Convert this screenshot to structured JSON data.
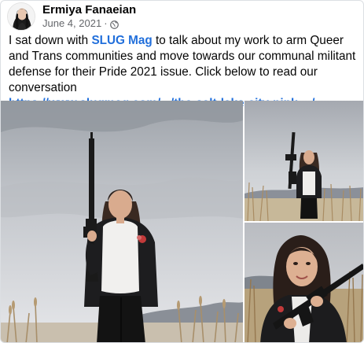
{
  "post": {
    "author": "Ermiya Fanaeian",
    "date": "June 4, 2021",
    "separator": "·",
    "privacy_icon": "globe-icon",
    "text_before_mention": "I sat down with ",
    "mention": "SLUG Mag",
    "text_after_mention": " to talk about my work to arm Queer and Trans communities and move towards our communal militant defense for their Pride 2021 issue. Click below to read our conversation",
    "link": "https://www.slugmag.com/.../the-salt-lake-city-pink-.../"
  },
  "colors": {
    "link": "#216fdb",
    "meta": "#65676b",
    "text": "#050505"
  },
  "photos": [
    {
      "name": "photo-main",
      "kind": "standing-portrait-with-rifle"
    },
    {
      "name": "photo-top-right",
      "kind": "full-body-with-rifle"
    },
    {
      "name": "photo-bottom-right",
      "kind": "close-up-with-rifle"
    }
  ]
}
